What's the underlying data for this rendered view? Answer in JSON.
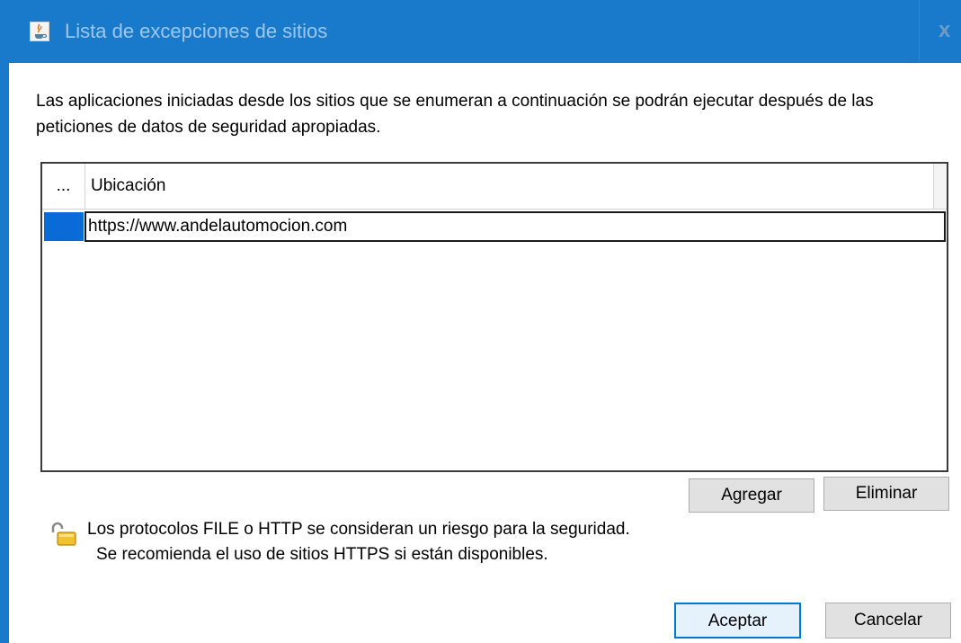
{
  "window": {
    "title": "Lista de excepciones de sitios",
    "close_label": "x",
    "icon": "java-cup-icon"
  },
  "description": "Las aplicaciones iniciadas desde los sitios que se enumeran a continuación se podrán ejecutar después de las peticiones de datos de seguridad apropiadas.",
  "table": {
    "columns": [
      "...",
      "Ubicación"
    ],
    "rows": [
      {
        "location": "https://www.andelautomocion.com",
        "selected": true
      }
    ]
  },
  "buttons": {
    "add": "Agregar",
    "remove": "Eliminar",
    "ok": "Aceptar",
    "cancel": "Cancelar"
  },
  "warning": {
    "icon": "open-lock-icon",
    "line1": "Los protocolos FILE o HTTP se consideran un riesgo para la seguridad.",
    "line2": "Se recomienda el uso de sitios HTTPS si están disponibles."
  },
  "colors": {
    "titlebar": "#1979ca",
    "selection": "#0a6ad8",
    "default_button_border": "#0078d7"
  }
}
